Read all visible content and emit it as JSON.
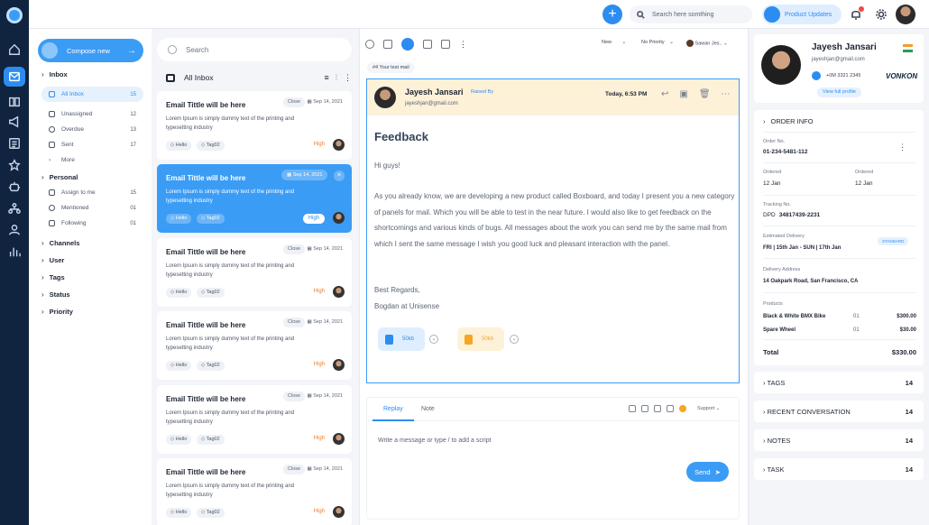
{
  "topbar": {
    "search_placeholder": "Search here somthing",
    "updates_label": "Product Updates"
  },
  "nav": {
    "compose_label": "Compose new",
    "sections": {
      "inbox": "Inbox",
      "personal": "Personal",
      "channels": "Channels",
      "user": "User",
      "tags": "Tags",
      "status": "Status",
      "priority": "Priority"
    },
    "inbox_items": [
      {
        "label": "All Inbox",
        "count": "15"
      },
      {
        "label": "Unassigned",
        "count": "12"
      },
      {
        "label": "Overdue",
        "count": "13"
      },
      {
        "label": "Sent",
        "count": "17"
      },
      {
        "label": "More",
        "count": ""
      }
    ],
    "personal_items": [
      {
        "label": "Assign to me",
        "count": "15"
      },
      {
        "label": "Mentioned",
        "count": "01"
      },
      {
        "label": "Following",
        "count": "01"
      }
    ]
  },
  "list": {
    "search_placeholder": "Search",
    "header": "All Inbox",
    "cards": [
      {
        "title": "Email Tittle will be here",
        "status": "Close",
        "date": "Sep 14, 2021",
        "body": "Lorem Ipsum is simply dummy text of the printing and typesetting industry",
        "tag1": "Hello",
        "tag2": "Tag02",
        "priority": "High"
      },
      {
        "title": "Email Tittle will be here",
        "status": "",
        "date": "Sep 14, 2021",
        "body": "Lorem Ipsum is simply dummy text of the printing and typesetting industry",
        "tag1": "Hello",
        "tag2": "Tag02",
        "priority": "High"
      },
      {
        "title": "Email Tittle will be here",
        "status": "Close",
        "date": "Sep 14, 2021",
        "body": "Lorem Ipsum is simply dummy text of the printing and typesetting industry",
        "tag1": "Hello",
        "tag2": "Tag02",
        "priority": "High"
      },
      {
        "title": "Email Tittle will be here",
        "status": "Close",
        "date": "Sep 14, 2021",
        "body": "Lorem Ipsum is simply dummy text of the printing and typesetting industry",
        "tag1": "Hello",
        "tag2": "Tag02",
        "priority": "High"
      },
      {
        "title": "Email Tittle will be here",
        "status": "Close",
        "date": "Sep 14, 2021",
        "body": "Lorem Ipsum is simply dummy text of the printing and typesetting industry",
        "tag1": "Hello",
        "tag2": "Tag02",
        "priority": "High"
      },
      {
        "title": "Email Tittle will be here",
        "status": "Close",
        "date": "Sep 14, 2021",
        "body": "Lorem Ipsum is simply dummy text of the printing and typesetting industry",
        "tag1": "Hello",
        "tag2": "Tag02",
        "priority": "High"
      }
    ]
  },
  "mail": {
    "status_select": "New",
    "priority_select": "No Priority",
    "assignee_select": "Sawan Jes..",
    "subject_tag": "#4  Your test mail",
    "sender_name": "Jayesh Jansari",
    "raised_by": "Raised By",
    "sender_email": "jayeshjan@gmail.com",
    "date": "Today, 6:53 PM",
    "heading": "Feedback",
    "greeting": "Hi guys!",
    "body": "As you already know, we are developing a new product called Boxboard, and today I present you a new category of panels for mail. Which you will be able to test in the near future. I would also like to get feedback on the shortcomings and various kinds of bugs. All messages about the work you can send me by the same mail from which I sent the same message I wish you good luck and pleasant interaction with the panel.",
    "sign1": "Best Regards,",
    "sign2": "Bogdan at Unisense",
    "attachments": [
      {
        "size": "50kb"
      },
      {
        "size": "50kb"
      }
    ]
  },
  "reply": {
    "tab_reply": "Replay",
    "tab_note": "Note",
    "support": "Support",
    "placeholder": "Write a message or type / to add  a script",
    "send_label": "Send"
  },
  "profile": {
    "name": "Jayesh Jansari",
    "email": "jayeshjan@gmail.com",
    "phone": "+0M 3321 2345",
    "brand": "VONKON",
    "view_profile": "View full profile"
  },
  "order": {
    "header": "ORDER INFO",
    "order_no_label": "Order No.",
    "order_no": "01-234-5481-112",
    "ordered_label1": "Ordered",
    "ordered_val1": "12 Jan",
    "ordered_label2": "Ordered",
    "ordered_val2": "12 Jan",
    "tracking_label": "Tracking No.",
    "tracking_prefix": "DPD",
    "tracking_val": "34817439-2231",
    "delivery_label": "Estimated Delivery",
    "delivery_badge": "STANDARD",
    "delivery_val": "FRI  |  15th Jan - SUN  |  17th Jan",
    "address_label": "Delivery Address",
    "address_val": "14 Oakpark Road, San Francisco, CA",
    "products_label": "Products",
    "products": [
      {
        "name": "Black & White BMX Bike",
        "qty": "01",
        "price": "$300.00"
      },
      {
        "name": "Spare Wheel",
        "qty": "01",
        "price": "$30.00"
      }
    ],
    "total_label": "Total",
    "total_val": "$330.00"
  },
  "sections": [
    {
      "label": "TAGS",
      "count": "14"
    },
    {
      "label": "RECENT CONVERSATION",
      "count": "14"
    },
    {
      "label": "NOTES",
      "count": "14"
    },
    {
      "label": "TASK",
      "count": "14"
    }
  ],
  "colors": {
    "accent": "#3b9cf5",
    "rail": "#10233f",
    "priority": "#f07a2c",
    "mail_header": "#fdf1d8"
  }
}
